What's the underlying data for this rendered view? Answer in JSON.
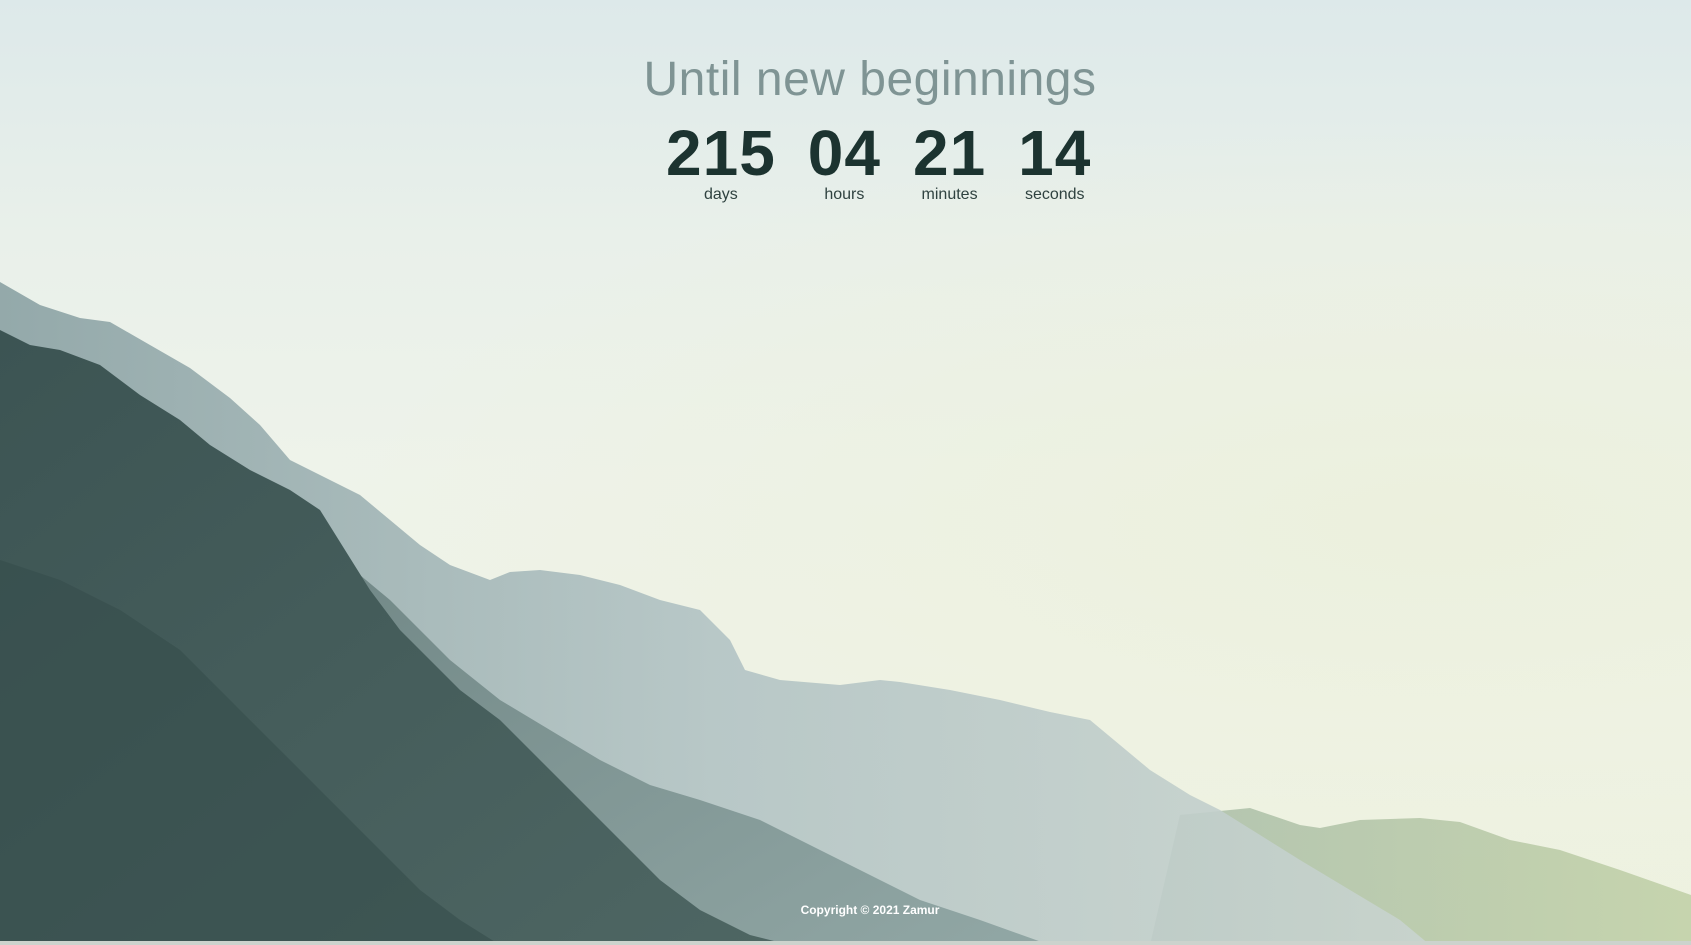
{
  "headline": "Until new beginnings",
  "countdown": [
    {
      "value": "215",
      "label": "days"
    },
    {
      "value": "04",
      "label": "hours"
    },
    {
      "value": "21",
      "label": "minutes"
    },
    {
      "value": "14",
      "label": "seconds"
    }
  ],
  "footer": {
    "copyright": "Copyright © 2021 Zamur"
  },
  "colors": {
    "headline": "#7f9494",
    "numbers": "#1c3330",
    "labels": "#2f4240",
    "footer": "#ffffff",
    "mountain_far": "#a9bcbc",
    "mountain_mid": "#6f8584",
    "mountain_near": "#3f5654",
    "mountain_green": "#9fb593"
  }
}
